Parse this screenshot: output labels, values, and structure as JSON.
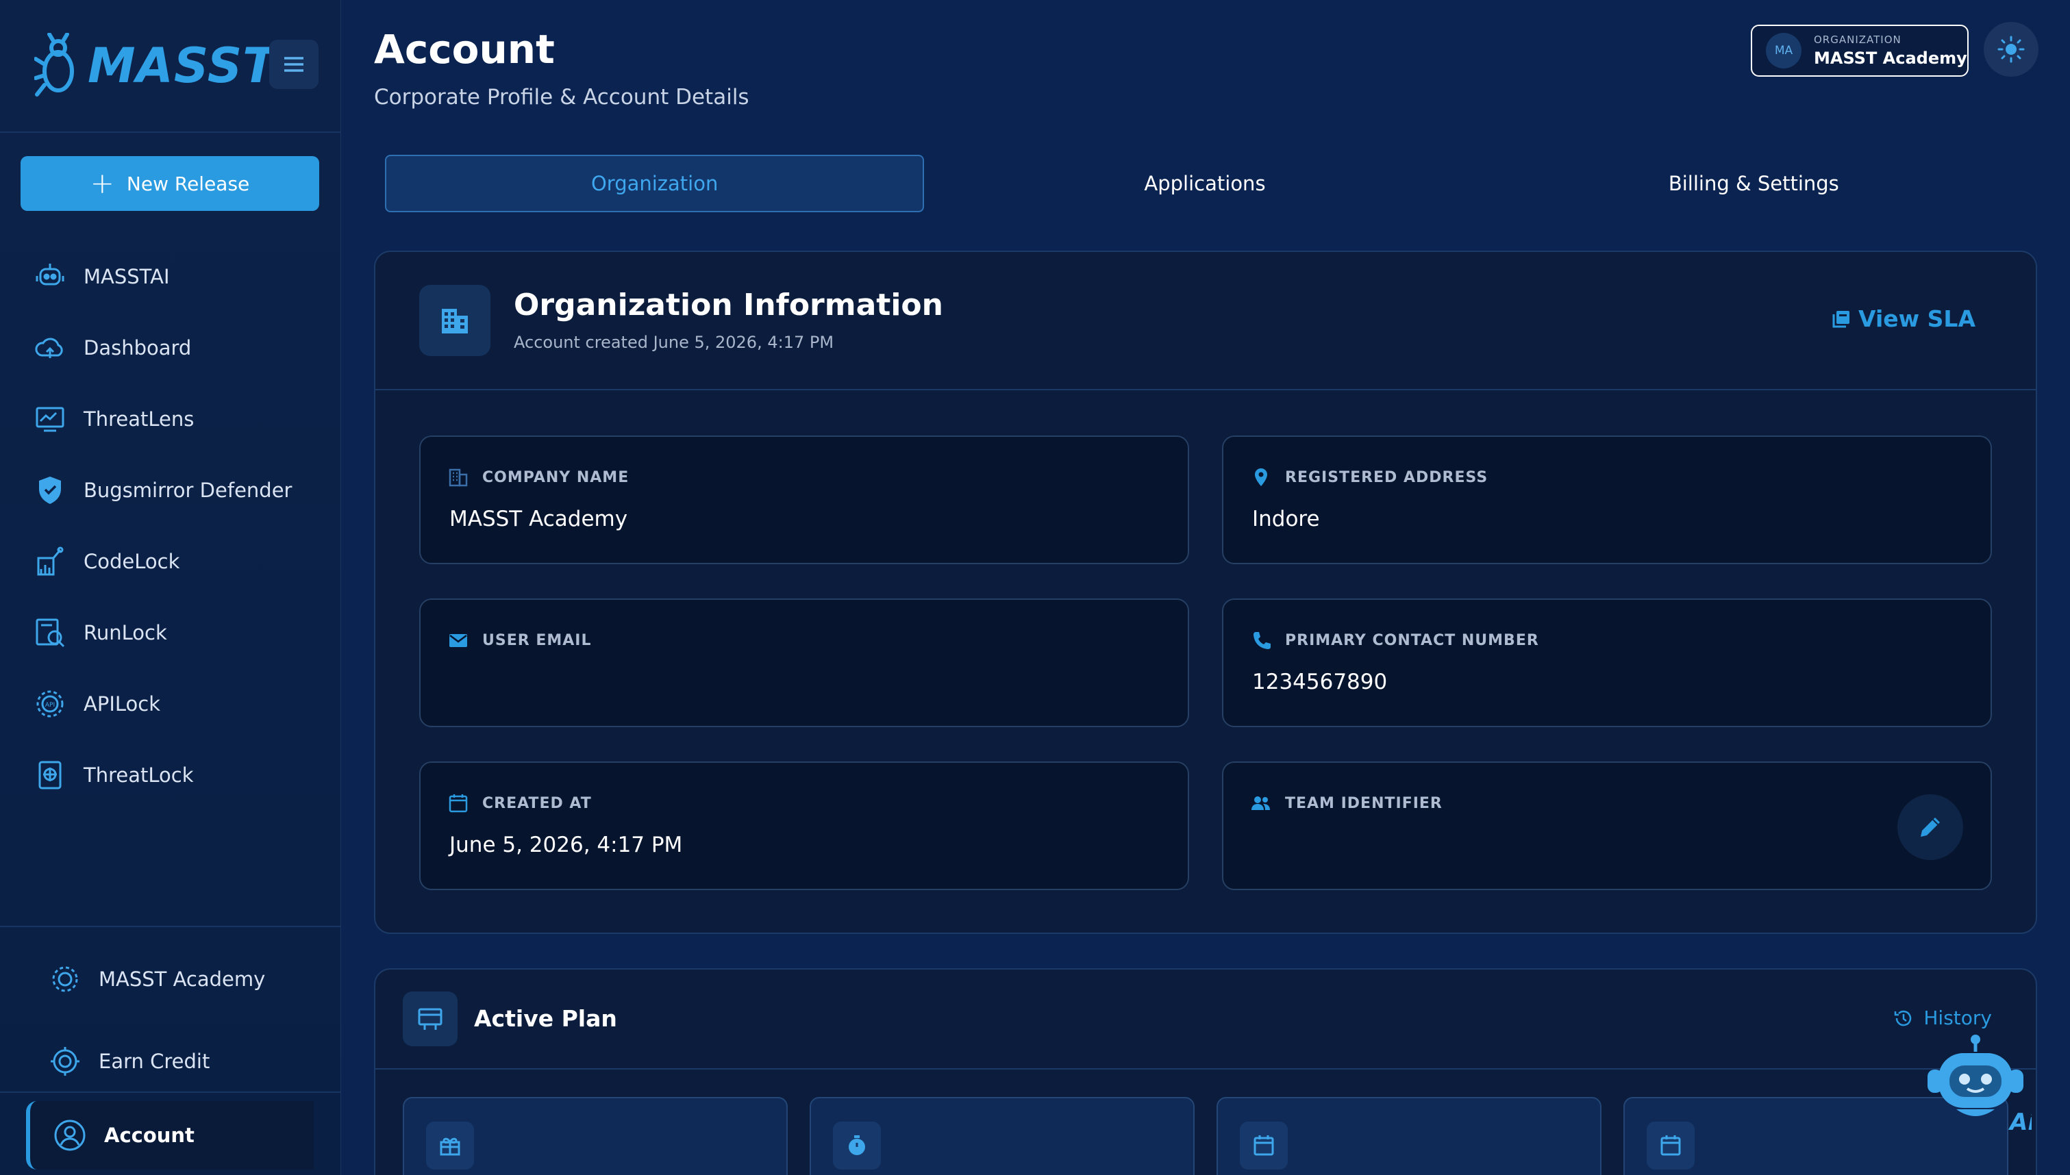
{
  "brand": {
    "name": "MASST"
  },
  "sidebar": {
    "new_release_label": "New Release",
    "items": [
      {
        "label": "MASSTAI",
        "icon": "robot-icon"
      },
      {
        "label": "Dashboard",
        "icon": "cloud-icon"
      },
      {
        "label": "ThreatLens",
        "icon": "monitor-icon"
      },
      {
        "label": "Bugsmirror Defender",
        "icon": "shield-icon"
      },
      {
        "label": "CodeLock",
        "icon": "code-lock-icon"
      },
      {
        "label": "RunLock",
        "icon": "runtime-icon"
      },
      {
        "label": "APILock",
        "icon": "api-gear-icon"
      },
      {
        "label": "ThreatLock",
        "icon": "threat-document-icon"
      }
    ],
    "bottom": {
      "academy_label": "MASST Academy",
      "earn_credit_label": "Earn Credit",
      "account_label": "Account"
    }
  },
  "header": {
    "title": "Account",
    "subtitle": "Corporate Profile & Account Details",
    "org_chip": {
      "initials": "MA",
      "label": "ORGANIZATION",
      "value": "MASST Academy"
    }
  },
  "tabs": [
    {
      "label": "Organization",
      "active": true
    },
    {
      "label": "Applications",
      "active": false
    },
    {
      "label": "Billing & Settings",
      "active": false
    }
  ],
  "org_info": {
    "title": "Organization Information",
    "created_text": "Account created June 5, 2026, 4:17 PM",
    "view_sla_label": "View SLA",
    "fields": {
      "company_name": {
        "label": "COMPANY NAME",
        "value": "MASST Academy"
      },
      "registered_address": {
        "label": "REGISTERED ADDRESS",
        "value": "Indore"
      },
      "user_email": {
        "label": "USER EMAIL",
        "value": ""
      },
      "primary_contact": {
        "label": "PRIMARY CONTACT NUMBER",
        "value": "1234567890"
      },
      "created_at": {
        "label": "CREATED AT",
        "value": "June 5, 2026, 4:17 PM"
      },
      "team_identifier": {
        "label": "TEAM IDENTIFIER",
        "value": ""
      }
    }
  },
  "active_plan": {
    "title": "Active Plan",
    "history_label": "History"
  },
  "colors": {
    "accent": "#2a9be0",
    "background": "#0b2350",
    "sidebar": "#0c2248",
    "card": "#0b1c3c",
    "field": "#07142e"
  }
}
